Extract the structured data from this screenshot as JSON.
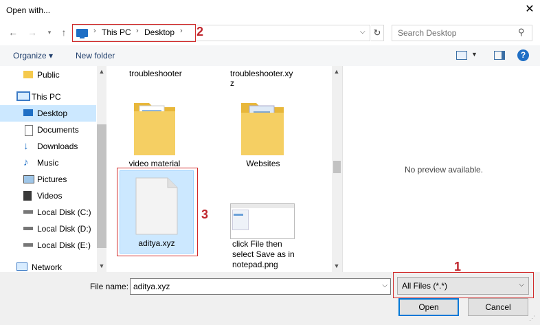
{
  "window": {
    "title": "Open with..."
  },
  "address": {
    "crumbs": [
      "This PC",
      "Desktop"
    ]
  },
  "search": {
    "placeholder": "Search Desktop"
  },
  "toolbar": {
    "organize": "Organize ▾",
    "new_folder": "New folder"
  },
  "sidebar": {
    "items": [
      {
        "label": "Public",
        "icon": "folder-icon"
      },
      {
        "label": "This PC",
        "icon": "pc-icon"
      },
      {
        "label": "Desktop",
        "icon": "desktop-icon",
        "selected": true
      },
      {
        "label": "Documents",
        "icon": "documents-icon"
      },
      {
        "label": "Downloads",
        "icon": "downloads-icon"
      },
      {
        "label": "Music",
        "icon": "music-icon"
      },
      {
        "label": "Pictures",
        "icon": "pictures-icon"
      },
      {
        "label": "Videos",
        "icon": "videos-icon"
      },
      {
        "label": "Local Disk (C:)",
        "icon": "disk-icon"
      },
      {
        "label": "Local Disk (D:)",
        "icon": "disk-icon"
      },
      {
        "label": "Local Disk (E:)",
        "icon": "disk-icon"
      },
      {
        "label": "Network",
        "icon": "network-icon"
      }
    ]
  },
  "files": {
    "top_labels": [
      "troubleshooter",
      "troubleshooter.xy z"
    ],
    "top_label_2_line1": "troubleshooter.xy",
    "top_label_2_line2": "z",
    "folders": [
      {
        "label": "video material"
      },
      {
        "label": "Websites"
      }
    ],
    "selected_file": {
      "label": "aditya.xyz"
    },
    "image_file": {
      "line1": "click File then",
      "line2": "select Save as in",
      "line3": "notepad.png"
    }
  },
  "preview": {
    "message": "No preview available."
  },
  "bottom": {
    "file_name_label": "File name:",
    "file_name_value": "aditya.xyz",
    "file_type": "All Files (*.*)",
    "open_label": "Open",
    "cancel_label": "Cancel"
  },
  "annotations": {
    "n1": "1",
    "n2": "2",
    "n3": "3"
  },
  "colors": {
    "accent": "#0078d7",
    "selection": "#cce8ff",
    "annotation": "#c0262d",
    "folder": "#f5c94c"
  }
}
